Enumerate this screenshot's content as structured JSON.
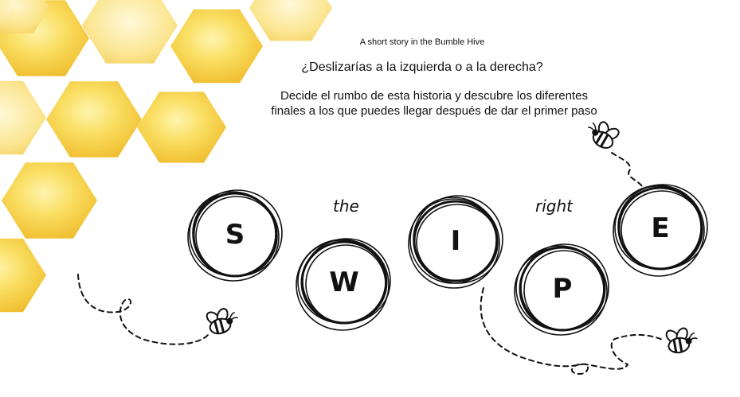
{
  "story": {
    "subtitle": "A short story in the Bumble Hive",
    "question": "¿Deslizarías a la izquierda o a la derecha?",
    "description": "Decide el rumbo de esta historia y descubre los diferentes finales a los que puedes llegar después de dar el primer paso"
  },
  "logo": {
    "letters": [
      "S",
      "W",
      "I",
      "P",
      "E"
    ],
    "words": [
      "the",
      "right"
    ]
  },
  "colors": {
    "honey_light": "#fbe46a",
    "honey_dark": "#efb71c",
    "ink": "#111111"
  },
  "icons": [
    "honeycomb-illustration",
    "bee-icon",
    "dashed-flight-path"
  ]
}
